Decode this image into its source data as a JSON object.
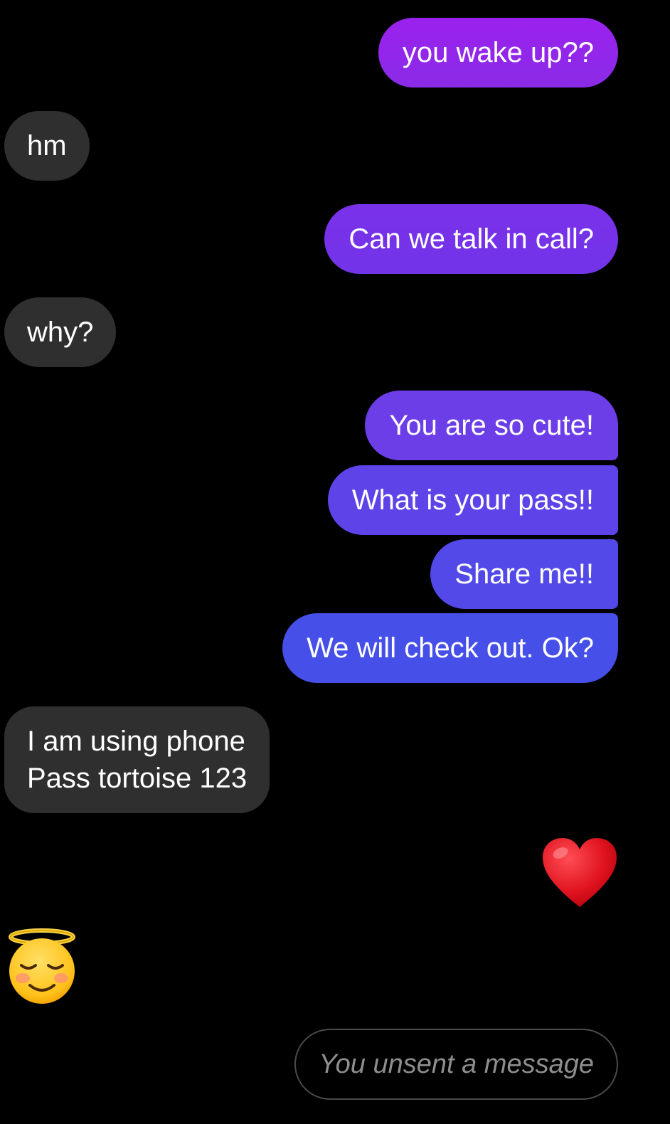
{
  "messages": [
    {
      "direction": "sent",
      "text": "you wake up??"
    },
    {
      "direction": "received",
      "text": "hm"
    },
    {
      "direction": "sent",
      "text": "Can we talk in call?"
    },
    {
      "direction": "received",
      "text": "why?"
    },
    {
      "direction": "sent",
      "text": "You are so cute!"
    },
    {
      "direction": "sent",
      "text": "What is your pass!!"
    },
    {
      "direction": "sent",
      "text": "Share me!!"
    },
    {
      "direction": "sent",
      "text": "We will check out. Ok?"
    },
    {
      "direction": "received",
      "lines": [
        "I am using phone",
        "Pass tortoise 123"
      ]
    },
    {
      "direction": "sent",
      "emoji": "red-heart-icon"
    },
    {
      "direction": "received",
      "emoji": "smiling-face-with-halo-icon"
    },
    {
      "direction": "sent",
      "unsent_notice": "You unsent a message"
    }
  ],
  "colors": {
    "background": "#000000",
    "received_bubble": "#2f2f2f",
    "sent_gradient_top": "#9b21ee",
    "sent_gradient_bottom": "#4650e8",
    "text": "#ffffff",
    "unsent_text": "#8e8e8e"
  }
}
